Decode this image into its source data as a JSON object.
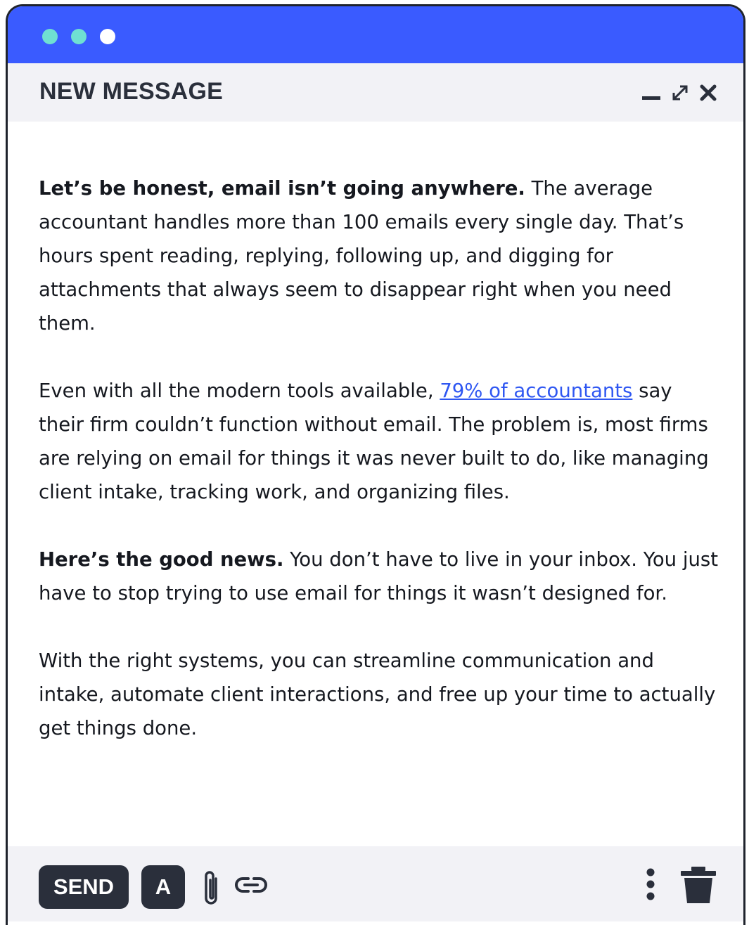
{
  "window": {
    "title": "NEW MESSAGE",
    "traffic_lights": [
      "teal",
      "teal",
      "white"
    ],
    "controls": [
      "minimize-icon",
      "expand-icon",
      "close-icon"
    ]
  },
  "message": {
    "p1_bold": "Let’s be honest, email isn’t going anywhere.",
    "p1_text": " The average accountant handles more than 100 emails every single day. That’s hours spent reading, replying, following up, and digging for attachments that always seem to disappear right when you need them.",
    "p2_pre": "Even with all the modern tools available, ",
    "p2_link": "79% of accountants",
    "p2_post": " say their firm couldn’t function without email. The problem is, most firms are relying on email for things it was never built to do, like managing client intake, tracking work, and organizing files.",
    "p3_bold": "Here’s the good news.",
    "p3_text": " You don’t have to live in your inbox. You just have to stop trying to use email for things it wasn’t designed for.",
    "p4_text": "With the right systems, you can streamline communication and intake, automate client interactions, and free up your time to actually get things done."
  },
  "toolbar": {
    "send_label": "SEND",
    "format_label": "A",
    "icons": [
      "paperclip-icon",
      "link-icon",
      "more-vertical-icon",
      "trash-icon"
    ]
  },
  "colors": {
    "titlebar": "#3a5bff",
    "dot_teal": "#6fe0d2",
    "panel": "#f2f2f6",
    "dark": "#2a2f3b",
    "link": "#2f57f2"
  }
}
